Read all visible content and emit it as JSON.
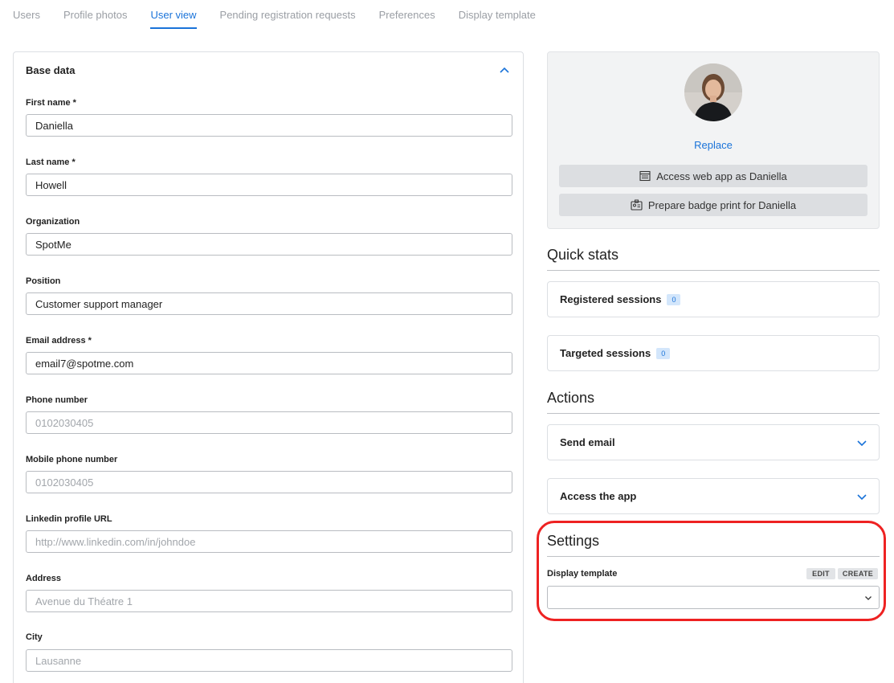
{
  "tabs": [
    "Users",
    "Profile photos",
    "User view",
    "Pending registration requests",
    "Preferences",
    "Display template"
  ],
  "active_tab": "User view",
  "base_data": {
    "title": "Base data",
    "fields": [
      {
        "label": "First name *",
        "value": "Daniella",
        "placeholder": ""
      },
      {
        "label": "Last name *",
        "value": "Howell",
        "placeholder": ""
      },
      {
        "label": "Organization",
        "value": "SpotMe",
        "placeholder": ""
      },
      {
        "label": "Position",
        "value": "Customer support manager",
        "placeholder": ""
      },
      {
        "label": "Email address *",
        "value": "email7@spotme.com",
        "placeholder": ""
      },
      {
        "label": "Phone number",
        "value": "",
        "placeholder": "0102030405"
      },
      {
        "label": "Mobile phone number",
        "value": "",
        "placeholder": "0102030405"
      },
      {
        "label": "Linkedin profile URL",
        "value": "",
        "placeholder": "http://www.linkedin.com/in/johndoe"
      },
      {
        "label": "Address",
        "value": "",
        "placeholder": "Avenue du Théatre 1"
      },
      {
        "label": "City",
        "value": "",
        "placeholder": "Lausanne"
      }
    ]
  },
  "profile": {
    "replace_label": "Replace",
    "access_web_app_label": "Access web app as Daniella",
    "badge_print_label": "Prepare badge print for Daniella"
  },
  "quick_stats": {
    "title": "Quick stats",
    "registered_sessions_label": "Registered sessions",
    "registered_sessions_count": "0",
    "targeted_sessions_label": "Targeted sessions",
    "targeted_sessions_count": "0"
  },
  "actions": {
    "title": "Actions",
    "send_email_label": "Send email",
    "access_app_label": "Access the app"
  },
  "settings": {
    "title": "Settings",
    "display_template_label": "Display template",
    "edit_label": "EDIT",
    "create_label": "CREATE",
    "selected_value": ""
  },
  "colors": {
    "accent": "#1a73d9",
    "highlight": "#ee2222"
  }
}
